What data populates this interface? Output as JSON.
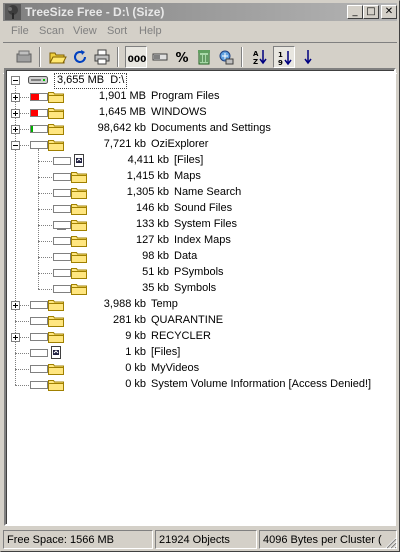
{
  "window": {
    "title": "TreeSize Free - D:\\ (Size)",
    "controls": {
      "minimize": "_",
      "maximize": "□",
      "close": "✕"
    }
  },
  "menu": [
    "File",
    "Scan",
    "View",
    "Sort",
    "Help"
  ],
  "toolbar": {
    "buttons": [
      "scan-drive-icon",
      "open-folder-icon",
      "refresh-icon",
      "print-icon",
      "show-size-icon",
      "show-allocated-icon",
      "percent-icon",
      "file-count-icon",
      "scan-network-icon",
      "sort-alpha-icon",
      "sort-size-icon",
      "sort-direction-icon"
    ],
    "percent_label": "%",
    "size_label": "000"
  },
  "tree": {
    "root": {
      "size": "3,655 MB",
      "name": "D:\\"
    },
    "items": [
      {
        "level": 1,
        "expand": "plus",
        "bar_color": "#ff0000",
        "bar_fill": 0.52,
        "size": "1,901 MB",
        "name": "Program Files",
        "icon": "folder"
      },
      {
        "level": 1,
        "expand": "plus",
        "bar_color": "#ff0000",
        "bar_fill": 0.45,
        "size": "1,645 MB",
        "name": "WINDOWS",
        "icon": "folder"
      },
      {
        "level": 1,
        "expand": "plus",
        "bar_color": "#00b000",
        "bar_fill": 0.03,
        "size": "98,642 kb",
        "name": "Documents and Settings",
        "icon": "folder"
      },
      {
        "level": 1,
        "expand": "minus",
        "bar_color": "#00b000",
        "bar_fill": 0.0,
        "size": "7,721 kb",
        "name": "OziExplorer",
        "icon": "folder"
      },
      {
        "level": 2,
        "expand": "",
        "bar_color": "#00b000",
        "bar_fill": 0.0,
        "size": "4,411 kb",
        "name": "[Files]",
        "icon": "files"
      },
      {
        "level": 2,
        "expand": "",
        "bar_color": "#00b000",
        "bar_fill": 0.0,
        "size": "1,415 kb",
        "name": "Maps",
        "icon": "folder"
      },
      {
        "level": 2,
        "expand": "",
        "bar_color": "#00b000",
        "bar_fill": 0.0,
        "size": "1,305 kb",
        "name": "Name Search",
        "icon": "folder"
      },
      {
        "level": 2,
        "expand": "",
        "bar_color": "#00b000",
        "bar_fill": 0.0,
        "size": "146 kb",
        "name": "Sound Files",
        "icon": "folder"
      },
      {
        "level": 2,
        "expand": "plus",
        "bar_color": "#00b000",
        "bar_fill": 0.0,
        "size": "133 kb",
        "name": "System Files",
        "icon": "folder"
      },
      {
        "level": 2,
        "expand": "",
        "bar_color": "#00b000",
        "bar_fill": 0.0,
        "size": "127 kb",
        "name": "Index Maps",
        "icon": "folder"
      },
      {
        "level": 2,
        "expand": "",
        "bar_color": "#00b000",
        "bar_fill": 0.0,
        "size": "98 kb",
        "name": "Data",
        "icon": "folder"
      },
      {
        "level": 2,
        "expand": "",
        "bar_color": "#00b000",
        "bar_fill": 0.0,
        "size": "51 kb",
        "name": "PSymbols",
        "icon": "folder"
      },
      {
        "level": 2,
        "expand": "",
        "bar_color": "#00b000",
        "bar_fill": 0.0,
        "size": "35 kb",
        "name": "Symbols",
        "icon": "folder"
      },
      {
        "level": 1,
        "expand": "plus",
        "bar_color": "#00b000",
        "bar_fill": 0.0,
        "size": "3,988 kb",
        "name": "Temp",
        "icon": "folder"
      },
      {
        "level": 1,
        "expand": "",
        "bar_color": "#00b000",
        "bar_fill": 0.0,
        "size": "281 kb",
        "name": "QUARANTINE",
        "icon": "folder"
      },
      {
        "level": 1,
        "expand": "plus",
        "bar_color": "#00b000",
        "bar_fill": 0.0,
        "size": "9 kb",
        "name": "RECYCLER",
        "icon": "folder"
      },
      {
        "level": 1,
        "expand": "",
        "bar_color": "#00b000",
        "bar_fill": 0.0,
        "size": "1 kb",
        "name": "[Files]",
        "icon": "files"
      },
      {
        "level": 1,
        "expand": "",
        "bar_color": "#00b000",
        "bar_fill": 0.0,
        "size": "0 kb",
        "name": "MyVideos",
        "icon": "folder"
      },
      {
        "level": 1,
        "expand": "",
        "bar_color": "#00b000",
        "bar_fill": 0.0,
        "size": "0 kb",
        "name": "System Volume Information [Access Denied!]",
        "icon": "folder"
      }
    ]
  },
  "status": {
    "free_space": "Free Space: 1566 MB",
    "objects": "21924 Objects",
    "cluster": "4096 Bytes per Cluster ("
  }
}
